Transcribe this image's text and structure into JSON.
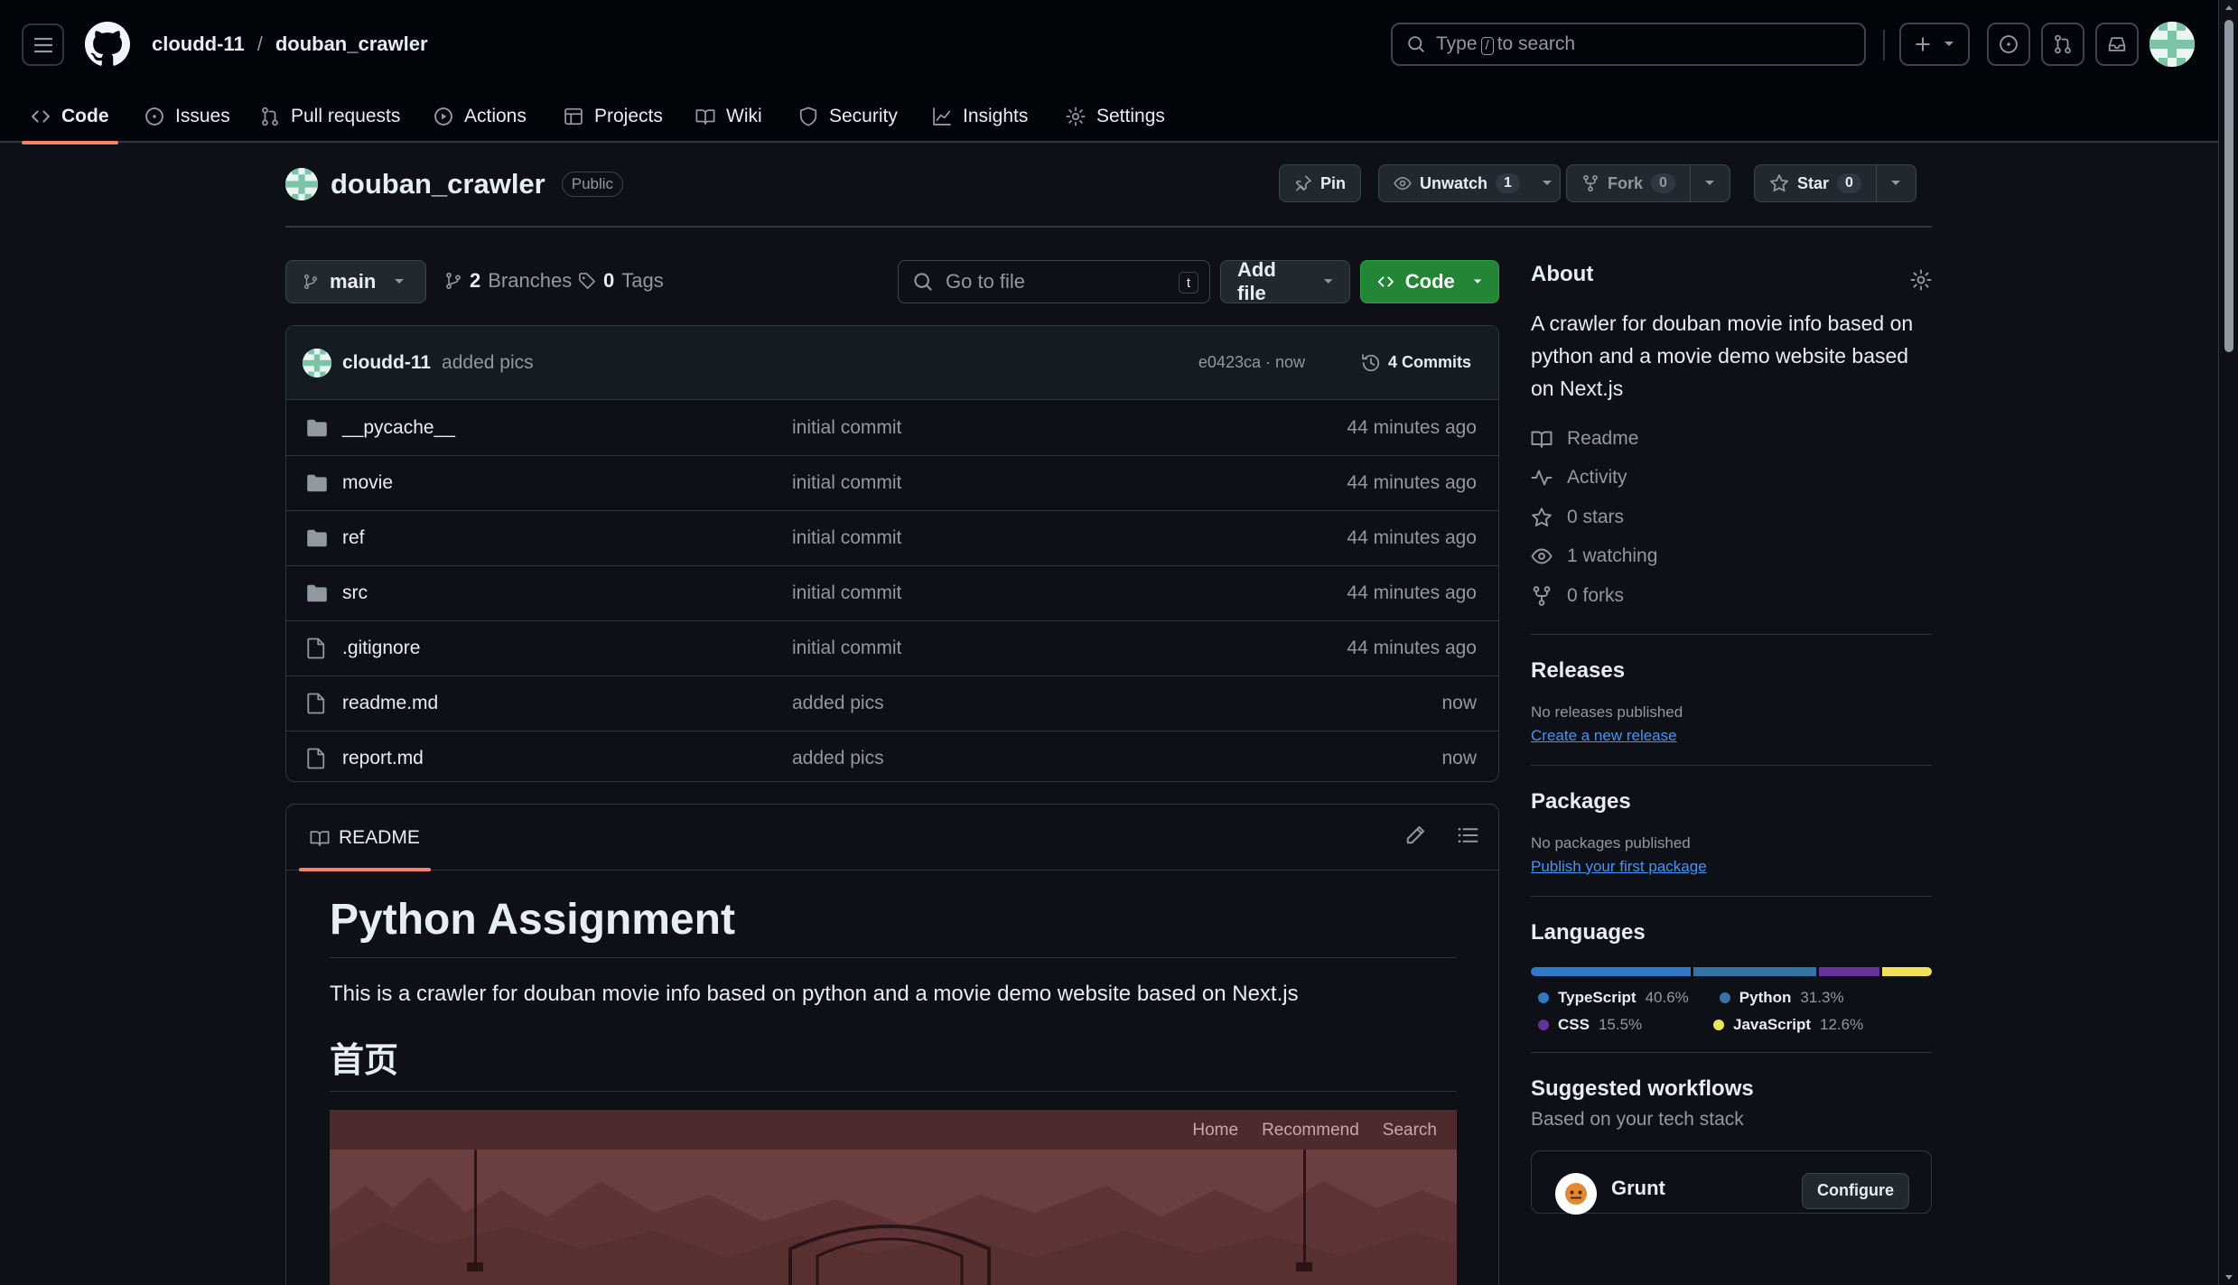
{
  "header": {
    "owner": "cloudd-11",
    "separator": "/",
    "repo": "douban_crawler",
    "search_prefix": "Type",
    "search_key": "/",
    "search_suffix": "to search"
  },
  "tabs": [
    {
      "label": "Code",
      "icon": "code-icon"
    },
    {
      "label": "Issues",
      "icon": "issue-icon"
    },
    {
      "label": "Pull requests",
      "icon": "pull-request-icon"
    },
    {
      "label": "Actions",
      "icon": "play-icon"
    },
    {
      "label": "Projects",
      "icon": "table-icon"
    },
    {
      "label": "Wiki",
      "icon": "book-icon"
    },
    {
      "label": "Security",
      "icon": "shield-icon"
    },
    {
      "label": "Insights",
      "icon": "graph-icon"
    },
    {
      "label": "Settings",
      "icon": "gear-icon"
    }
  ],
  "repo": {
    "name": "douban_crawler",
    "visibility": "Public",
    "pin_label": "Pin",
    "unwatch_label": "Unwatch",
    "watch_count": "1",
    "fork_label": "Fork",
    "fork_count": "0",
    "star_label": "Star",
    "star_count": "0"
  },
  "filenav": {
    "branch": "main",
    "branches_count": "2",
    "branches_label": "Branches",
    "tags_count": "0",
    "tags_label": "Tags",
    "goto_placeholder": "Go to file",
    "goto_key": "t",
    "add_file_label": "Add file",
    "code_label": "Code"
  },
  "commit": {
    "user": "cloudd-11",
    "message": "added pics",
    "meta": "e0423ca · now",
    "commits_label": "4 Commits"
  },
  "files": [
    {
      "name": "__pycache__",
      "type": "folder",
      "message": "initial commit",
      "time": "44 minutes ago"
    },
    {
      "name": "movie",
      "type": "folder",
      "message": "initial commit",
      "time": "44 minutes ago"
    },
    {
      "name": "ref",
      "type": "folder",
      "message": "initial commit",
      "time": "44 minutes ago"
    },
    {
      "name": "src",
      "type": "folder",
      "message": "initial commit",
      "time": "44 minutes ago"
    },
    {
      "name": ".gitignore",
      "type": "file",
      "message": "initial commit",
      "time": "44 minutes ago"
    },
    {
      "name": "readme.md",
      "type": "file",
      "message": "added pics",
      "time": "now"
    },
    {
      "name": "report.md",
      "type": "file",
      "message": "added pics",
      "time": "now"
    }
  ],
  "readme": {
    "tab_label": "README",
    "title": "Python Assignment",
    "intro": "This is a crawler for douban movie info based on python and a movie demo website based on Next.js",
    "section_heading": "首页",
    "preview_nav": [
      "Home",
      "Recommend",
      "Search"
    ]
  },
  "about": {
    "heading": "About",
    "description": "A crawler for douban movie info based on python and a movie demo website based on Next.js",
    "items": [
      {
        "label": "Readme",
        "icon": "book-icon"
      },
      {
        "label": "Activity",
        "icon": "pulse-icon"
      },
      {
        "label": "0 stars",
        "icon": "star-icon"
      },
      {
        "label": "1 watching",
        "icon": "eye-icon"
      },
      {
        "label": "0 forks",
        "icon": "fork-icon"
      }
    ]
  },
  "releases": {
    "heading": "Releases",
    "status": "No releases published",
    "link": "Create a new release"
  },
  "packages": {
    "heading": "Packages",
    "status": "No packages published",
    "link": "Publish your first package"
  },
  "languages": {
    "heading": "Languages",
    "items": [
      {
        "name": "TypeScript",
        "percent": "40.6%",
        "value": 40.6,
        "color": "#3178c6"
      },
      {
        "name": "Python",
        "percent": "31.3%",
        "value": 31.3,
        "color": "#3572a5"
      },
      {
        "name": "CSS",
        "percent": "15.5%",
        "value": 15.5,
        "color": "#663399"
      },
      {
        "name": "JavaScript",
        "percent": "12.6%",
        "value": 12.6,
        "color": "#f1e05a"
      }
    ]
  },
  "workflows": {
    "heading": "Suggested workflows",
    "subheading": "Based on your tech stack",
    "card_name": "Grunt",
    "card_button": "Configure"
  },
  "colors": {
    "accent_tab": "#f78166",
    "green_button": "#238636",
    "link": "#4493f8"
  }
}
